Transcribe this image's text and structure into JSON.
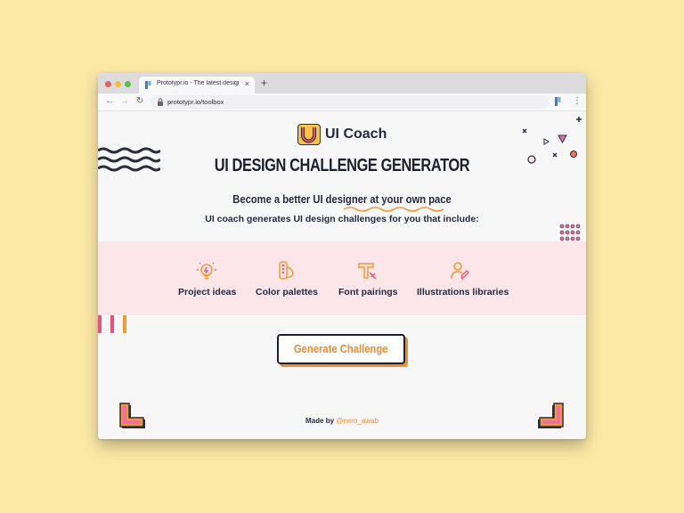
{
  "browser": {
    "tab_title": "Prototypr.io - The latest design and",
    "tab_close": "×",
    "new_tab": "+",
    "url": "prototypr.io/toolbox",
    "nav": {
      "back": "←",
      "forward": "→",
      "reload": "↻"
    },
    "star": "☆",
    "menu": "⋮"
  },
  "header": {
    "logo_letter": "U",
    "logo_text": "UI Coach"
  },
  "main": {
    "title": "UI DESIGN CHALLENGE GENERATOR",
    "subtitle_prefix": "Become a better UI designer ",
    "subtitle_highlight": "at your own pace",
    "intro": "UI coach generates UI design challenges for you that include:",
    "features": [
      {
        "label": "Project ideas",
        "icon": "lightbulb-icon"
      },
      {
        "label": "Color palettes",
        "icon": "palette-icon"
      },
      {
        "label": "Font pairings",
        "icon": "typography-icon"
      },
      {
        "label": "Illustrations libraries",
        "icon": "illustrator-icon"
      }
    ],
    "button_label": "Generate Challenge"
  },
  "footer": {
    "made_by": "Made by ",
    "handle": "@nero_awab"
  },
  "colors": {
    "background": "#fde9a6",
    "accent": "#f08c2b",
    "band": "#fde6e9",
    "dark": "#1d1f2e"
  }
}
